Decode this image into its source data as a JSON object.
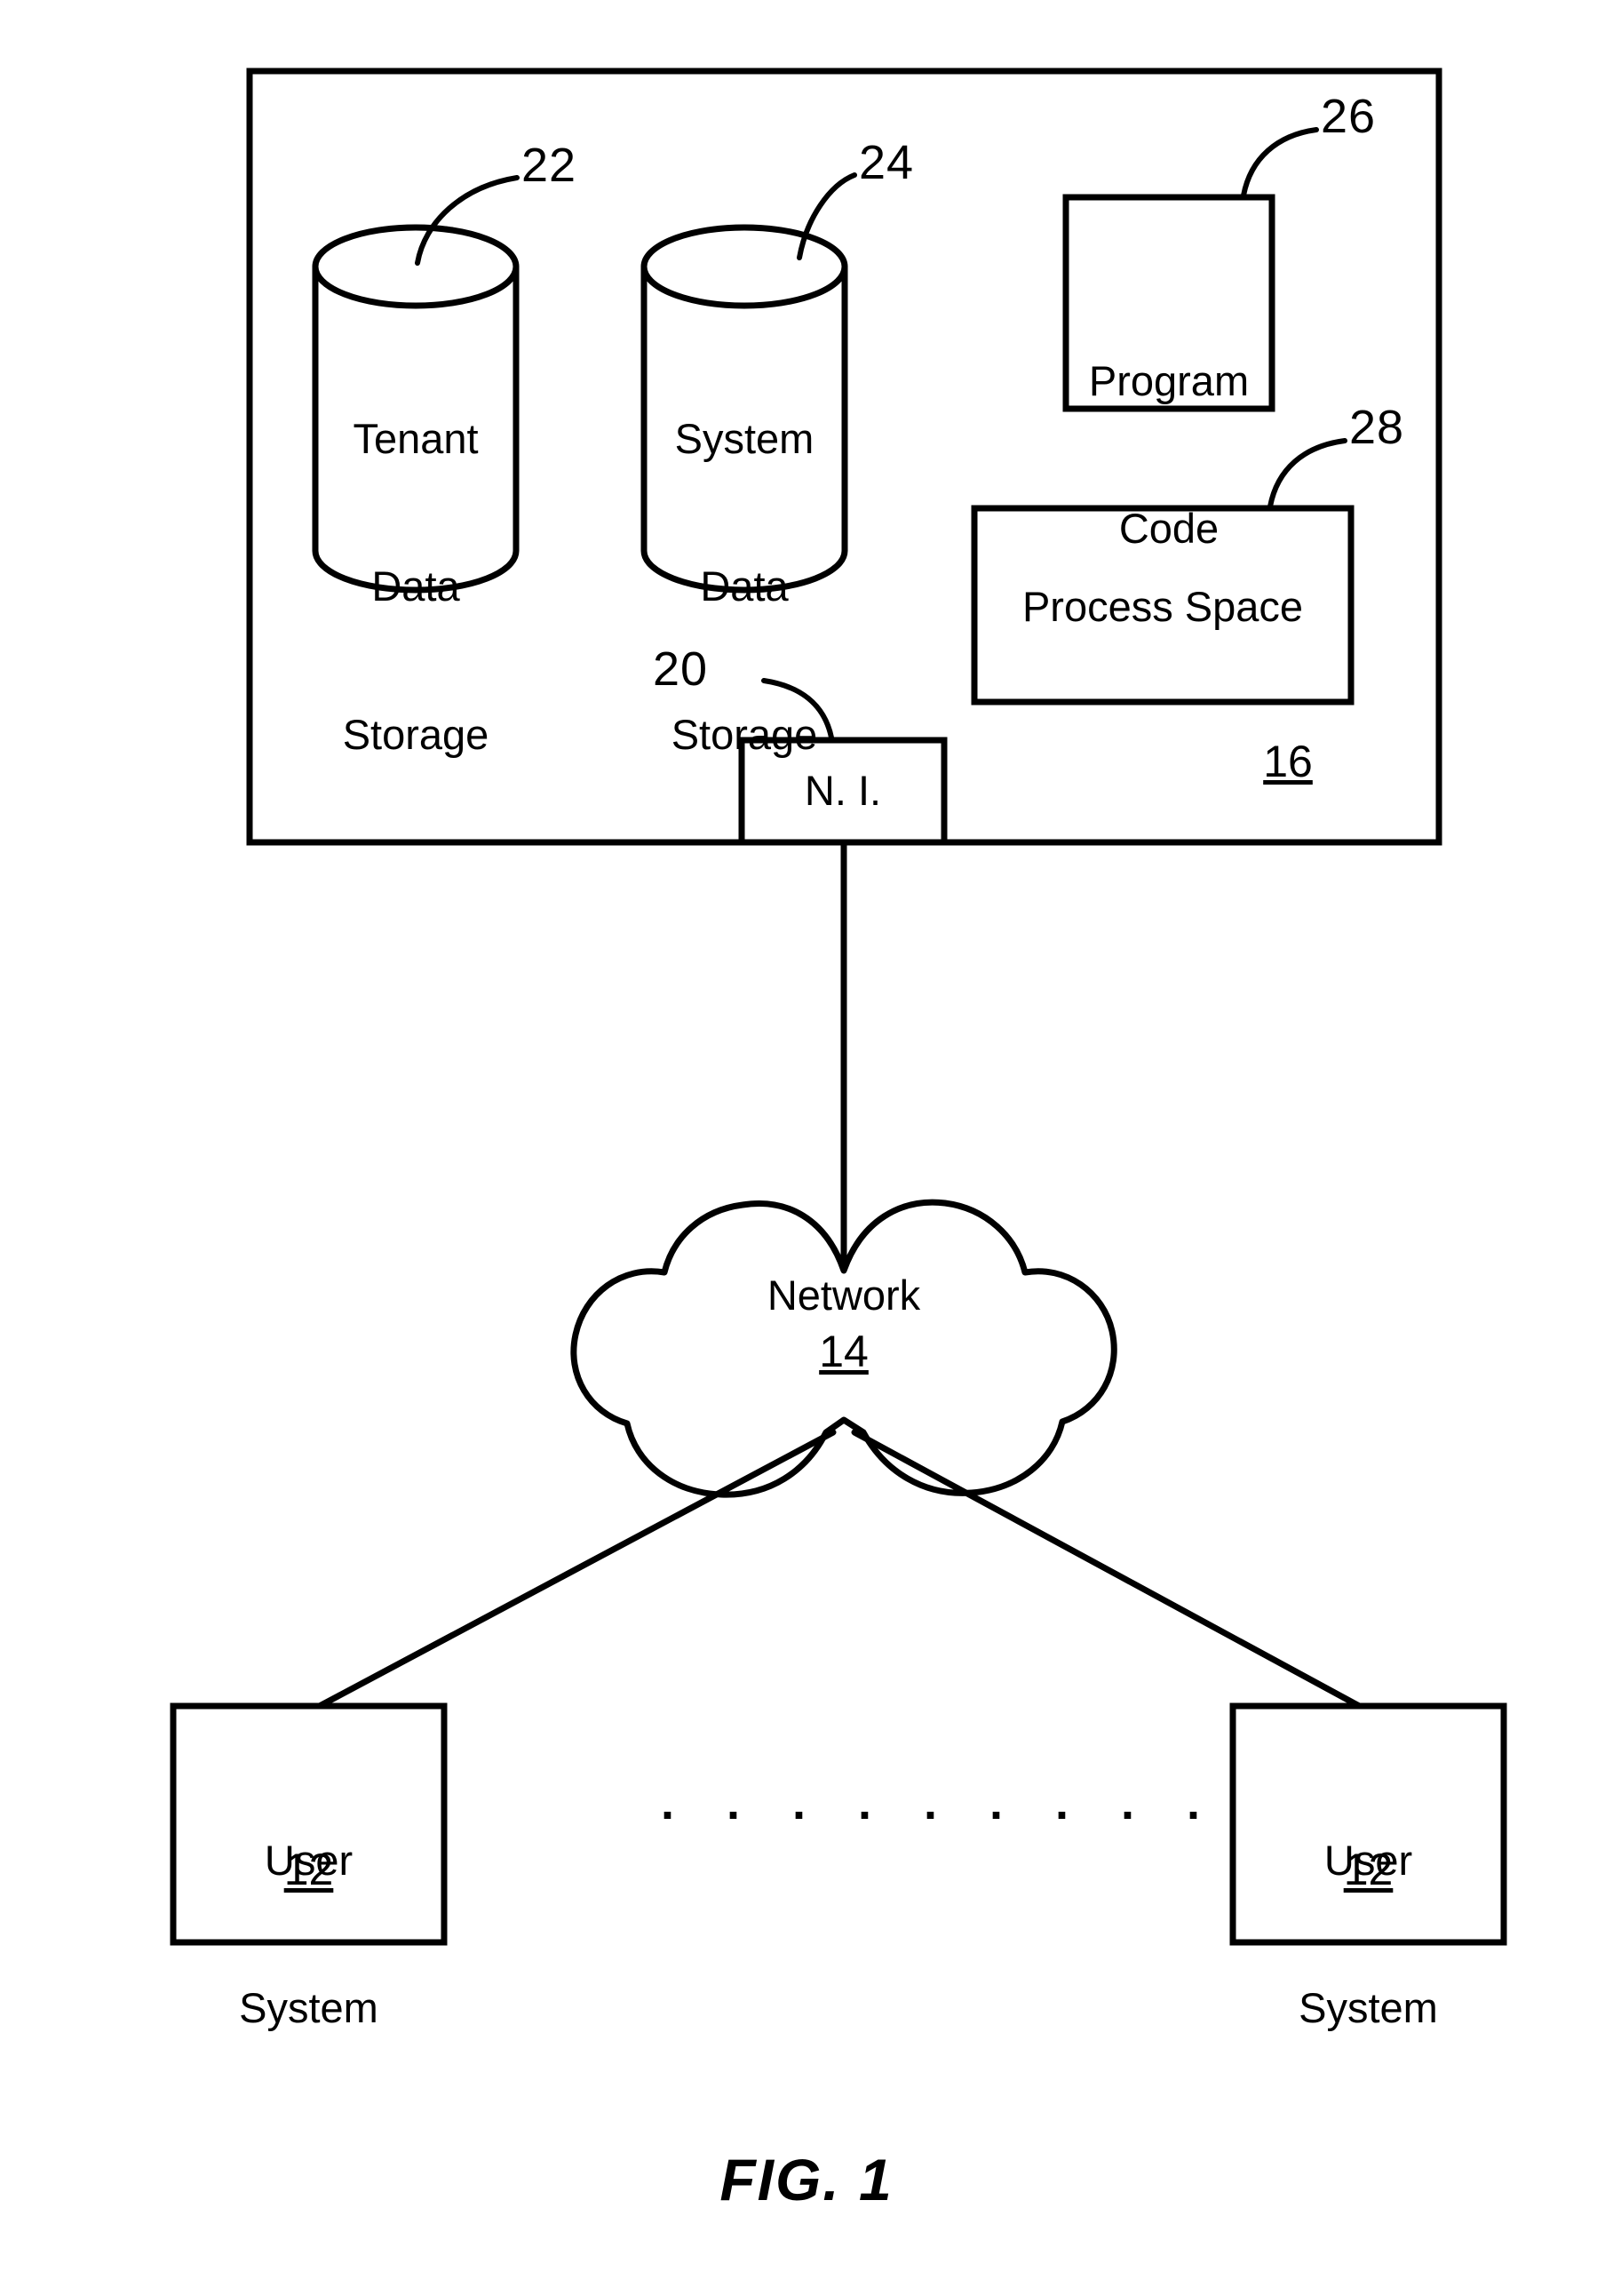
{
  "figure": {
    "caption": "FIG. 1",
    "system_ref": "16"
  },
  "system_box": {
    "ref_label": "16",
    "tenant_storage": {
      "ref_label": "22",
      "line1": "Tenant",
      "line2": "Data",
      "line3": "Storage"
    },
    "system_storage": {
      "ref_label": "24",
      "line1": "System",
      "line2": "Data",
      "line3": "Storage"
    },
    "program_code": {
      "ref_label": "26",
      "line1": "Program",
      "line2": "Code"
    },
    "process_space": {
      "ref_label": "28",
      "label": "Process Space"
    },
    "network_interface": {
      "ref_label": "20",
      "label": "N. I."
    }
  },
  "network_cloud": {
    "label": "Network",
    "ref_label": "14"
  },
  "user_systems": [
    {
      "line1": "User",
      "line2": "System",
      "ref_label": "12"
    },
    {
      "line1": "User",
      "line2": "System",
      "ref_label": "12"
    }
  ],
  "ellipsis": ". . . . . . . . .",
  "colors": {
    "line": "#000000",
    "background": "#ffffff",
    "text": "#000000"
  }
}
